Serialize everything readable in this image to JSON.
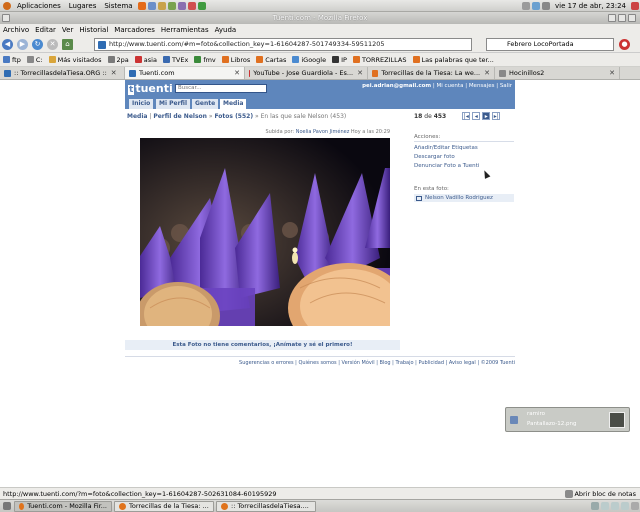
{
  "gnome": {
    "menus": [
      "Aplicaciones",
      "Lugares",
      "Sistema"
    ],
    "clock": "vie 17 de abr, 23:24"
  },
  "window": {
    "title": "Tuenti.com - Mozilla Firefox"
  },
  "menubar": [
    "Archivo",
    "Editar",
    "Ver",
    "Historial",
    "Marcadores",
    "Herramientas",
    "Ayuda"
  ],
  "navigation": {
    "url": "http://www.tuenti.com/#m=foto&collection_key=1-61604287-501749334-59511205",
    "search_value": "Febrero LocoPortada"
  },
  "bookmarks": [
    "ftp",
    "C:",
    "Más visitados",
    "2pa",
    "asia",
    "TVEx",
    "fmv",
    "Libros",
    "Cartas",
    "iGoogle",
    "IP",
    "TORREZILLAS",
    "Las palabras que ter..."
  ],
  "tabs": [
    {
      "label": ":: TorrecillasdelaTiesa.ORG ::",
      "active": false
    },
    {
      "label": "Tuenti.com",
      "active": true
    },
    {
      "label": "YouTube - Jose Guardiola - Es...",
      "active": false
    },
    {
      "label": "Torrecillas de la Tiesa: La we...",
      "active": false
    },
    {
      "label": "Hocinillos2",
      "active": false
    }
  ],
  "tuenti": {
    "logo": "tuenti",
    "search_placeholder": "Buscar...",
    "user_email": "pei.adrian@gmail.com",
    "links": [
      "Mi cuenta",
      "Mensajes",
      "Salir"
    ],
    "nav_tabs": [
      "Inicio",
      "Mi Perfil",
      "Gente",
      "Media"
    ],
    "breadcrumb": {
      "root": "Media",
      "profile": "Perfil de Nelson",
      "photos": "Fotos (552)",
      "current": "» En las que sale Nelson (453)"
    },
    "pager": {
      "position": "18",
      "of": "de",
      "total": "453"
    },
    "uploaded_by_label": "Subida por:",
    "uploader": "Noelia Pavon Jiménez",
    "uploaded_time": "Hoy a las 20:29",
    "actions_title": "Acciones:",
    "actions": [
      "Añadir/Editar Etiquetas",
      "Descargar foto",
      "Denunciar Foto a Tuenti"
    ],
    "in_photo_title": "En esta foto:",
    "in_photo_person": "Nelson Vadillo Rodriguez",
    "no_comments": "Esta Foto no tiene comentarios, ¡Anímate y sé el primero!",
    "footer_links": [
      "Sugerencias o errores",
      "Quiénes somos",
      "Versión Móvil",
      "Blog",
      "Trabajo",
      "Publicidad",
      "Aviso legal",
      "©2009 Tuenti"
    ]
  },
  "notification": {
    "user": "ramiro",
    "file": "Pantallazo-12.png"
  },
  "statusbar": {
    "url": "http://www.tuenti.com/?m=foto&collection_key=1-61604287-502631084-60195929",
    "notes": "Abrir bloc de notas"
  },
  "taskbar": [
    {
      "label": "Tuenti.com - Mozilla Fir...",
      "active": true
    },
    {
      "label": "Torrecillas de la Tiesa: ...",
      "active": false
    },
    {
      "label": ":: TorrecillasdelaTiesa....",
      "active": false
    }
  ],
  "colors": {
    "tuenti_blue": "#5e86bc",
    "link_blue": "#3b5a8c",
    "hood_purple": "#6b45b8"
  }
}
